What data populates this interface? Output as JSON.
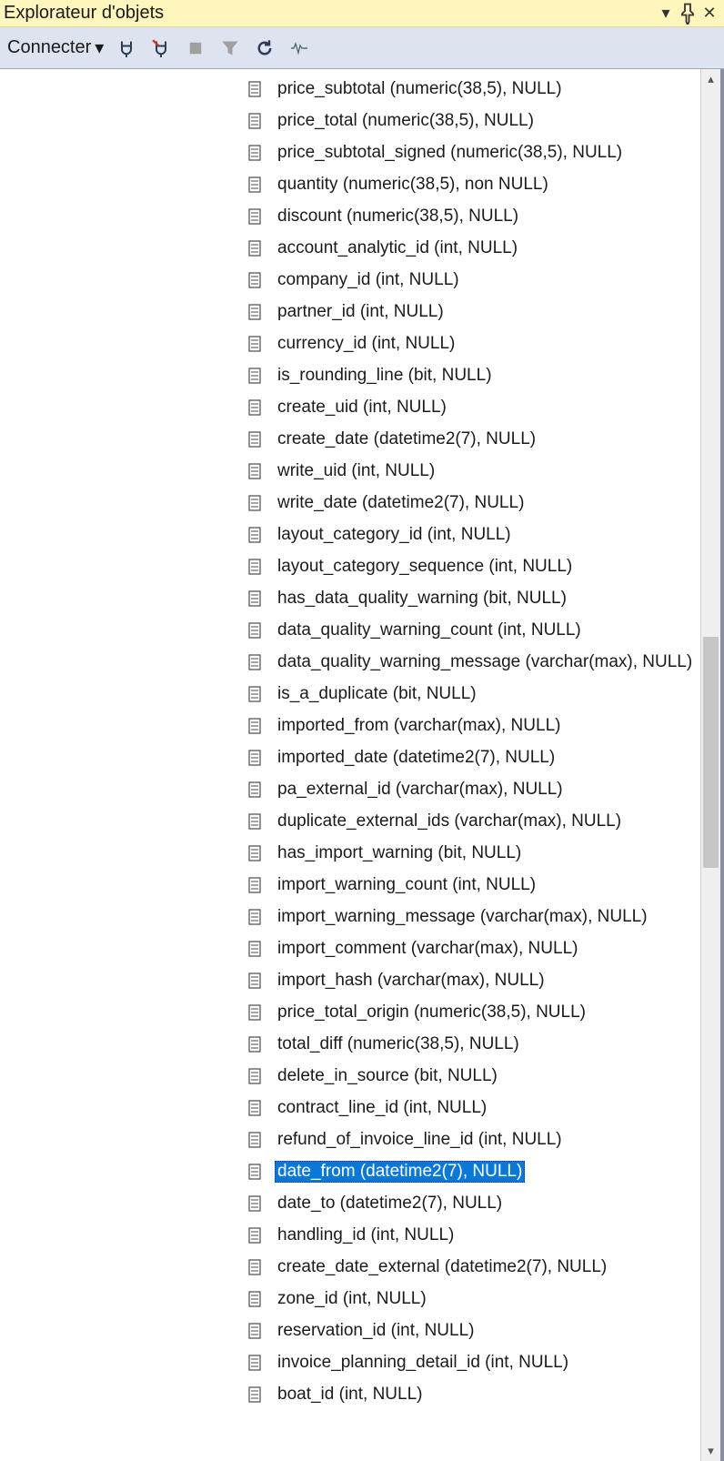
{
  "titlebar": {
    "title": "Explorateur d'objets"
  },
  "toolbar": {
    "connect_label": "Connecter"
  },
  "selected_index": 37,
  "columns": [
    {
      "label": "price_subtotal (numeric(38,5), NULL)"
    },
    {
      "label": "price_total (numeric(38,5), NULL)"
    },
    {
      "label": "price_subtotal_signed (numeric(38,5), NULL)"
    },
    {
      "label": "quantity (numeric(38,5), non NULL)"
    },
    {
      "label": "discount (numeric(38,5), NULL)"
    },
    {
      "label": "account_analytic_id (int, NULL)"
    },
    {
      "label": "company_id (int, NULL)"
    },
    {
      "label": "partner_id (int, NULL)"
    },
    {
      "label": "currency_id (int, NULL)"
    },
    {
      "label": "is_rounding_line (bit, NULL)"
    },
    {
      "label": "create_uid (int, NULL)"
    },
    {
      "label": "create_date (datetime2(7), NULL)"
    },
    {
      "label": "write_uid (int, NULL)"
    },
    {
      "label": "write_date (datetime2(7), NULL)"
    },
    {
      "label": "layout_category_id (int, NULL)"
    },
    {
      "label": "layout_category_sequence (int, NULL)"
    },
    {
      "label": "has_data_quality_warning (bit, NULL)"
    },
    {
      "label": "data_quality_warning_count (int, NULL)"
    },
    {
      "label": "data_quality_warning_message (varchar(max), NULL)"
    },
    {
      "label": "is_a_duplicate (bit, NULL)"
    },
    {
      "label": "imported_from (varchar(max), NULL)"
    },
    {
      "label": "imported_date (datetime2(7), NULL)"
    },
    {
      "label": "pa_external_id (varchar(max), NULL)"
    },
    {
      "label": "duplicate_external_ids (varchar(max), NULL)"
    },
    {
      "label": "has_import_warning (bit, NULL)"
    },
    {
      "label": "import_warning_count (int, NULL)"
    },
    {
      "label": "import_warning_message (varchar(max), NULL)"
    },
    {
      "label": "import_comment (varchar(max), NULL)"
    },
    {
      "label": "import_hash (varchar(max), NULL)"
    },
    {
      "label": "price_total_origin (numeric(38,5), NULL)"
    },
    {
      "label": "total_diff (numeric(38,5), NULL)"
    },
    {
      "label": "delete_in_source (bit, NULL)"
    },
    {
      "label": "contract_line_id (int, NULL)"
    },
    {
      "label": "refund_of_invoice_line_id (int, NULL)"
    },
    {
      "label": "date_from (datetime2(7), NULL)"
    },
    {
      "label": "date_to (datetime2(7), NULL)"
    },
    {
      "label": "handling_id (int, NULL)"
    },
    {
      "label": "create_date_external (datetime2(7), NULL)"
    },
    {
      "label": "zone_id (int, NULL)"
    },
    {
      "label": "reservation_id (int, NULL)"
    },
    {
      "label": "invoice_planning_detail_id (int, NULL)"
    },
    {
      "label": "boat_id (int, NULL)"
    }
  ]
}
